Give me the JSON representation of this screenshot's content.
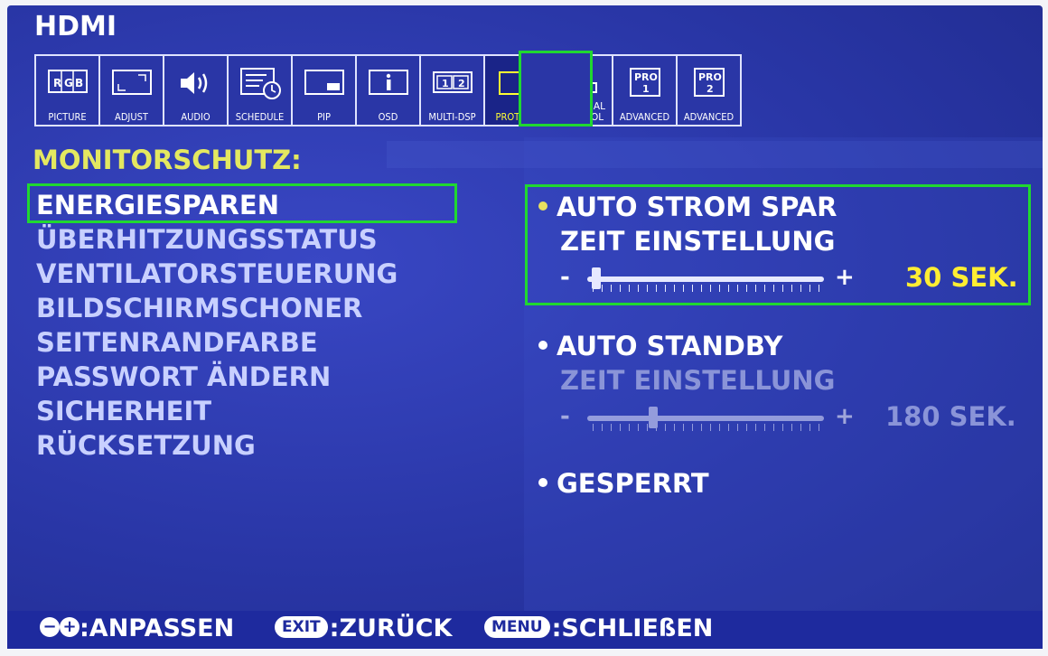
{
  "window": {
    "title": "HDMI"
  },
  "tabs": [
    {
      "label": "PICTURE",
      "icon": "rgb-picture-icon"
    },
    {
      "label": "ADJUST",
      "icon": "adjust-icon"
    },
    {
      "label": "AUDIO",
      "icon": "speaker-icon"
    },
    {
      "label": "SCHEDULE",
      "icon": "schedule-icon"
    },
    {
      "label": "PIP",
      "icon": "pip-icon"
    },
    {
      "label": "OSD",
      "icon": "info-icon"
    },
    {
      "label": "MULTI-DSP",
      "icon": "multi-display-icon"
    },
    {
      "label": "PROTECT",
      "icon": "protect-shield-icon",
      "selected": true
    },
    {
      "label": "EXTERNAL CONTROL",
      "label_line1": "EXTERNAL",
      "label_line2": "CONTROL",
      "icon": "external-control-icon"
    },
    {
      "label": "ADVANCED",
      "badge": "PRO 1",
      "badge_l1": "PRO",
      "badge_l2": "1",
      "icon": "pro1-icon"
    },
    {
      "label": "ADVANCED",
      "badge": "PRO 2",
      "badge_l1": "PRO",
      "badge_l2": "2",
      "icon": "pro2-icon"
    }
  ],
  "section_title": "MONITORSCHUTZ:",
  "menu_items": [
    "ENERGIESPAREN",
    "ÜBERHITZUNGSSTATUS",
    "VENTILATORSTEUERUNG",
    "BILDSCHIRMSCHONER",
    "SEITENRANDFARBE",
    "PASSWORT ÄNDERN",
    "SICHERHEIT",
    "RÜCKSETZUNG"
  ],
  "options": {
    "auto_power_save": {
      "label": "AUTO STROM SPAR",
      "sub": "ZEIT EINSTELLUNG",
      "value": "30 SEK.",
      "level": 0.04,
      "minus": "-",
      "plus": "+"
    },
    "auto_standby": {
      "label": "AUTO STANDBY",
      "sub": "ZEIT EINSTELLUNG",
      "value": "180 SEK.",
      "level": 0.28,
      "minus": "-",
      "plus": "+"
    },
    "locked": {
      "label": "GESPERRT"
    }
  },
  "footer": {
    "adjust_label": ":ANPASSEN",
    "exit_key": "EXIT",
    "exit_label": ":ZURÜCK",
    "menu_key": "MENU",
    "menu_label": ":SCHLIEßEN"
  },
  "colors": {
    "background": "#2a35a8",
    "highlight_outline": "#20d830",
    "section_yellow": "#e4e860",
    "value_yellow": "#ffee33"
  }
}
